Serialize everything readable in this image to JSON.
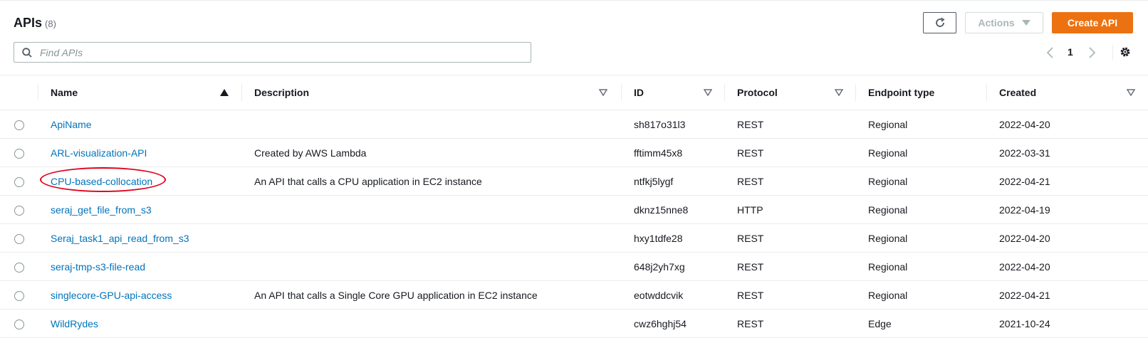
{
  "header": {
    "title": "APIs",
    "count": "(8)",
    "refresh_icon": "refresh-icon",
    "actions_label": "Actions",
    "create_label": "Create API"
  },
  "search": {
    "placeholder": "Find APIs",
    "value": ""
  },
  "pagination": {
    "current_page": "1"
  },
  "table": {
    "columns": [
      "Name",
      "Description",
      "ID",
      "Protocol",
      "Endpoint type",
      "Created"
    ],
    "rows": [
      {
        "name": "ApiName",
        "description": "",
        "id": "sh817o31l3",
        "protocol": "REST",
        "endpoint": "Regional",
        "created": "2022-04-20"
      },
      {
        "name": "ARL-visualization-API",
        "description": "Created by AWS Lambda",
        "id": "fftimm45x8",
        "protocol": "REST",
        "endpoint": "Regional",
        "created": "2022-03-31"
      },
      {
        "name": "CPU-based-collocation",
        "description": "An API that calls a CPU application in EC2 instance",
        "id": "ntfkj5lygf",
        "protocol": "REST",
        "endpoint": "Regional",
        "created": "2022-04-21"
      },
      {
        "name": "seraj_get_file_from_s3",
        "description": "",
        "id": "dknz15nne8",
        "protocol": "HTTP",
        "endpoint": "Regional",
        "created": "2022-04-19"
      },
      {
        "name": "Seraj_task1_api_read_from_s3",
        "description": "",
        "id": "hxy1tdfe28",
        "protocol": "REST",
        "endpoint": "Regional",
        "created": "2022-04-20"
      },
      {
        "name": "seraj-tmp-s3-file-read",
        "description": "",
        "id": "648j2yh7xg",
        "protocol": "REST",
        "endpoint": "Regional",
        "created": "2022-04-20"
      },
      {
        "name": "singlecore-GPU-api-access",
        "description": "An API that calls a Single Core GPU application in EC2 instance",
        "id": "eotwddcvik",
        "protocol": "REST",
        "endpoint": "Regional",
        "created": "2022-04-21"
      },
      {
        "name": "WildRydes",
        "description": "",
        "id": "cwz6hghj54",
        "protocol": "REST",
        "endpoint": "Edge",
        "created": "2021-10-24"
      }
    ]
  },
  "colors": {
    "accent": "#ec7211",
    "link": "#0073bb",
    "annotation": "#e0001b"
  }
}
